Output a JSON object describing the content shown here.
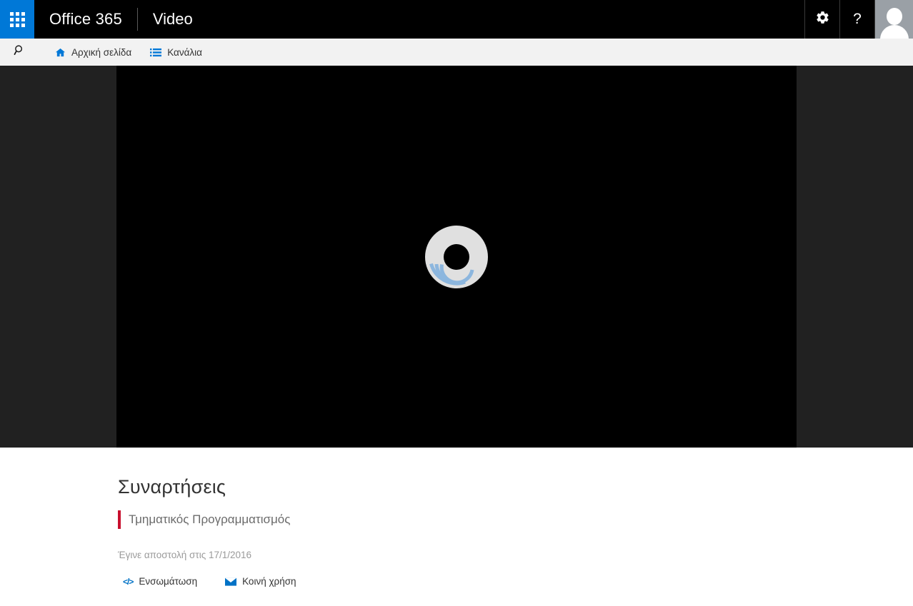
{
  "suite_bar": {
    "app_launcher": "app-launcher",
    "brand": "Office 365",
    "app_name": "Video",
    "settings_label": "settings-gear",
    "help_label": "?",
    "account_label": "account-avatar"
  },
  "nav_bar": {
    "search_label": "search",
    "items": [
      {
        "label": "Αρχική σελίδα",
        "icon": "home-icon"
      },
      {
        "label": "Κανάλια",
        "icon": "list-icon"
      }
    ]
  },
  "player": {
    "state": "loading",
    "spinner_icon": "loading-spinner",
    "ring_color": "#e0e0e0",
    "arc_color": "#8cb6de",
    "background": "#000000",
    "stage_background": "#212121"
  },
  "details": {
    "title": "Συναρτήσεις",
    "channel": "Τμηματικός Προγραμματισμός",
    "channel_accent": "#c8102e",
    "uploaded": "Έγινε αποστολή στις 17/1/2016",
    "actions": [
      {
        "label": "Ενσωμάτωση",
        "icon": "embed-code-icon",
        "glyph": "</>"
      },
      {
        "label": "Κοινή χρήση",
        "icon": "envelope-icon"
      }
    ]
  },
  "theme": {
    "accent": "#0078d7",
    "link": "#0072c6",
    "suite_bar_bg": "#000000",
    "nav_bar_bg": "#f2f2f2"
  }
}
